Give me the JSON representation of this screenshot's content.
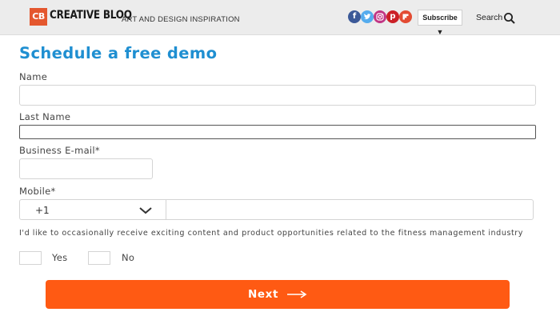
{
  "header": {
    "logo_badge": "CB",
    "logo_name": "CREATIVE BLOQ",
    "tagline": "ART AND DESIGN INSPIRATION",
    "social": [
      {
        "name": "facebook-icon",
        "glyph": "f",
        "color": "#3b5998"
      },
      {
        "name": "twitter-icon",
        "glyph": "t",
        "color": "#55acee"
      },
      {
        "name": "instagram-icon",
        "glyph": "◎",
        "color": "#c13584"
      },
      {
        "name": "pinterest-icon",
        "glyph": "p",
        "color": "#cb2027"
      },
      {
        "name": "flipboard-icon",
        "glyph": "f",
        "color": "#e34b32"
      }
    ],
    "subscribe_label": "Subscribe ▼",
    "search_label": "Search"
  },
  "form": {
    "title": "Schedule a free demo",
    "name_label": "Name",
    "name_value": "",
    "last_name_label": "Last Name",
    "last_name_value": "",
    "email_label": "Business E-mail*",
    "email_value": "",
    "mobile_label": "Mobile*",
    "country_code": "+1",
    "phone_value": "",
    "consent_text": "I'd like to occasionally receive exciting content and product opportunities related to the fitness management industry",
    "yes_label": "Yes",
    "no_label": "No",
    "next_label": "Next"
  },
  "colors": {
    "title_blue": "#1f8fd1",
    "next_button": "#ff5a13",
    "logo_orange": "#e4572e"
  }
}
